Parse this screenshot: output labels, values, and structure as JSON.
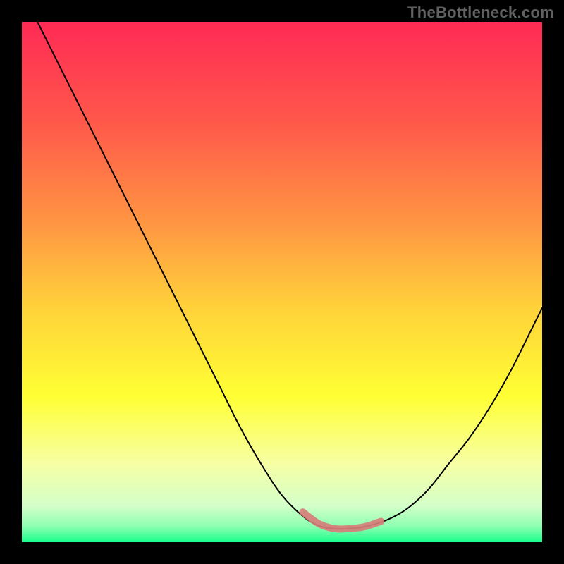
{
  "watermark": "TheBottleneck.com",
  "colors": {
    "bg": "#000000",
    "watermark": "#606060",
    "curve_stroke": "#000000",
    "highlight_stroke": "#d77d79"
  },
  "chart_data": {
    "type": "line",
    "title": "",
    "xlabel": "",
    "ylabel": "",
    "xlim": [
      0,
      100
    ],
    "ylim": [
      0,
      100
    ],
    "gradient_stops": [
      {
        "offset": 0.0,
        "color": "#ff2a55"
      },
      {
        "offset": 0.2,
        "color": "#ff5a4a"
      },
      {
        "offset": 0.4,
        "color": "#ff9a42"
      },
      {
        "offset": 0.55,
        "color": "#ffd23a"
      },
      {
        "offset": 0.72,
        "color": "#ffff33"
      },
      {
        "offset": 0.85,
        "color": "#f6ffa5"
      },
      {
        "offset": 0.93,
        "color": "#d4ffc9"
      },
      {
        "offset": 0.97,
        "color": "#8cffb1"
      },
      {
        "offset": 1.0,
        "color": "#18ff8b"
      }
    ],
    "series": [
      {
        "name": "bottleneck-curve",
        "x": [
          3,
          6,
          10,
          14,
          18,
          22,
          26,
          30,
          34,
          38,
          42,
          46,
          50,
          54,
          57,
          60,
          63,
          66,
          70,
          74,
          78,
          82,
          86,
          90,
          94,
          98,
          100
        ],
        "y": [
          100,
          94,
          86,
          78,
          70,
          62,
          54,
          46,
          38,
          30,
          22,
          15,
          9,
          5,
          3.2,
          2.6,
          2.6,
          3.0,
          4.2,
          6.4,
          10,
          15,
          20,
          26,
          33,
          41,
          45
        ]
      }
    ],
    "annotations": [
      {
        "name": "optimal-band",
        "type": "segment",
        "x": [
          54,
          57,
          60,
          63,
          66,
          69
        ],
        "y": [
          5.8,
          3.6,
          2.6,
          2.6,
          3.0,
          4.0
        ]
      }
    ]
  }
}
